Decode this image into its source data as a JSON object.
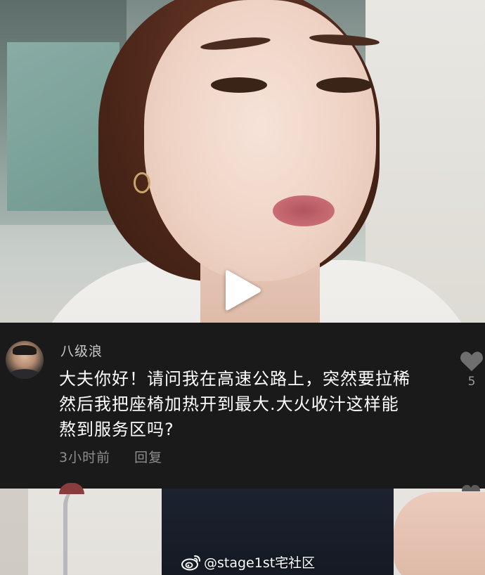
{
  "comment": {
    "username": "八级浪",
    "text": "大夫你好！请问我在高速公路上，突然要拉稀\n然后我把座椅加热开到最大.大火收汁这样能\n熬到服务区吗?",
    "time": "3小时前",
    "reply_label": "回复",
    "like_count": "5"
  },
  "watermark": {
    "text": "@stage1st宅社区"
  },
  "icons": {
    "play": "play-icon",
    "like": "heart-icon",
    "weibo": "weibo-logo-icon"
  },
  "colors": {
    "comment_bg": "#1a1a1a",
    "comment_text": "#ffffff",
    "meta_text": "#8e8e8e"
  }
}
